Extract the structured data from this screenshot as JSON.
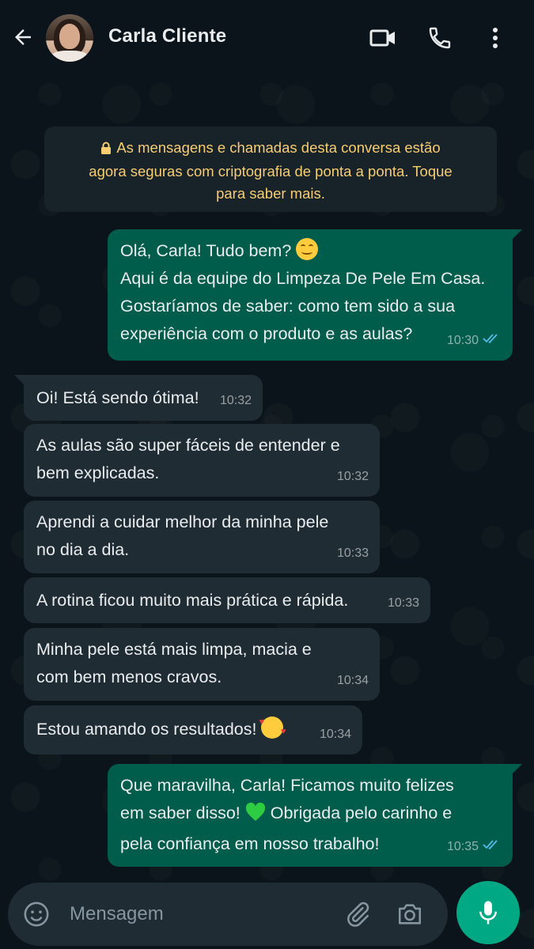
{
  "header": {
    "contact_name": "Carla Cliente",
    "icons": [
      "back-arrow-icon",
      "video-call-icon",
      "phone-icon",
      "more-vert-icon"
    ]
  },
  "notice": {
    "line1": "As mensagens e chamadas desta conversa estão",
    "line2": "agora seguras com criptografia de ponta a ponta. Toque",
    "line3": "para saber mais."
  },
  "messages": [
    {
      "direction": "out",
      "lines": [
        "Olá, Carla! Tudo bem?",
        "Aqui é da equipe do Limpeza De Pele Em Casa.",
        "Gostaríamos de saber: como tem sido a sua",
        "experiência com o produto e as aulas?"
      ],
      "time": "10:30",
      "status": "read"
    },
    {
      "direction": "in",
      "lines": [
        "Oi! Está sendo ótima!"
      ],
      "time": "10:32"
    },
    {
      "direction": "in",
      "lines": [
        "As aulas são super fáceis de entender e",
        "bem explicadas."
      ],
      "time": "10:32"
    },
    {
      "direction": "in",
      "lines": [
        "Aprendi a cuidar melhor da minha pele",
        "no dia a dia."
      ],
      "time": "10:33"
    },
    {
      "direction": "in",
      "lines": [
        "A rotina ficou muito mais prática e rápida."
      ],
      "time": "10:33"
    },
    {
      "direction": "in",
      "lines": [
        "Minha pele está mais limpa, macia e",
        "com bem menos cravos."
      ],
      "time": "10:34"
    },
    {
      "direction": "in",
      "lines": [
        "Estou amando os resultados!"
      ],
      "time": "10:34"
    },
    {
      "direction": "out",
      "lines": [
        "Que maravilha, Carla! Ficamos muito felizes",
        "em saber disso!",
        "Obrigada pelo carinho e",
        "pela confiança em nosso trabalho!"
      ],
      "time": "10:35",
      "status": "read"
    }
  ],
  "input": {
    "placeholder": "Mensagem",
    "icons": [
      "emoji-icon",
      "attach-icon",
      "camera-icon",
      "mic-icon"
    ]
  },
  "colors": {
    "background": "#0b141a",
    "outgoing_bubble": "#005c4b",
    "incoming_bubble": "#202c33",
    "notice_text": "#f7cd73",
    "read_ticks": "#53bdeb",
    "accent": "#00a884"
  }
}
